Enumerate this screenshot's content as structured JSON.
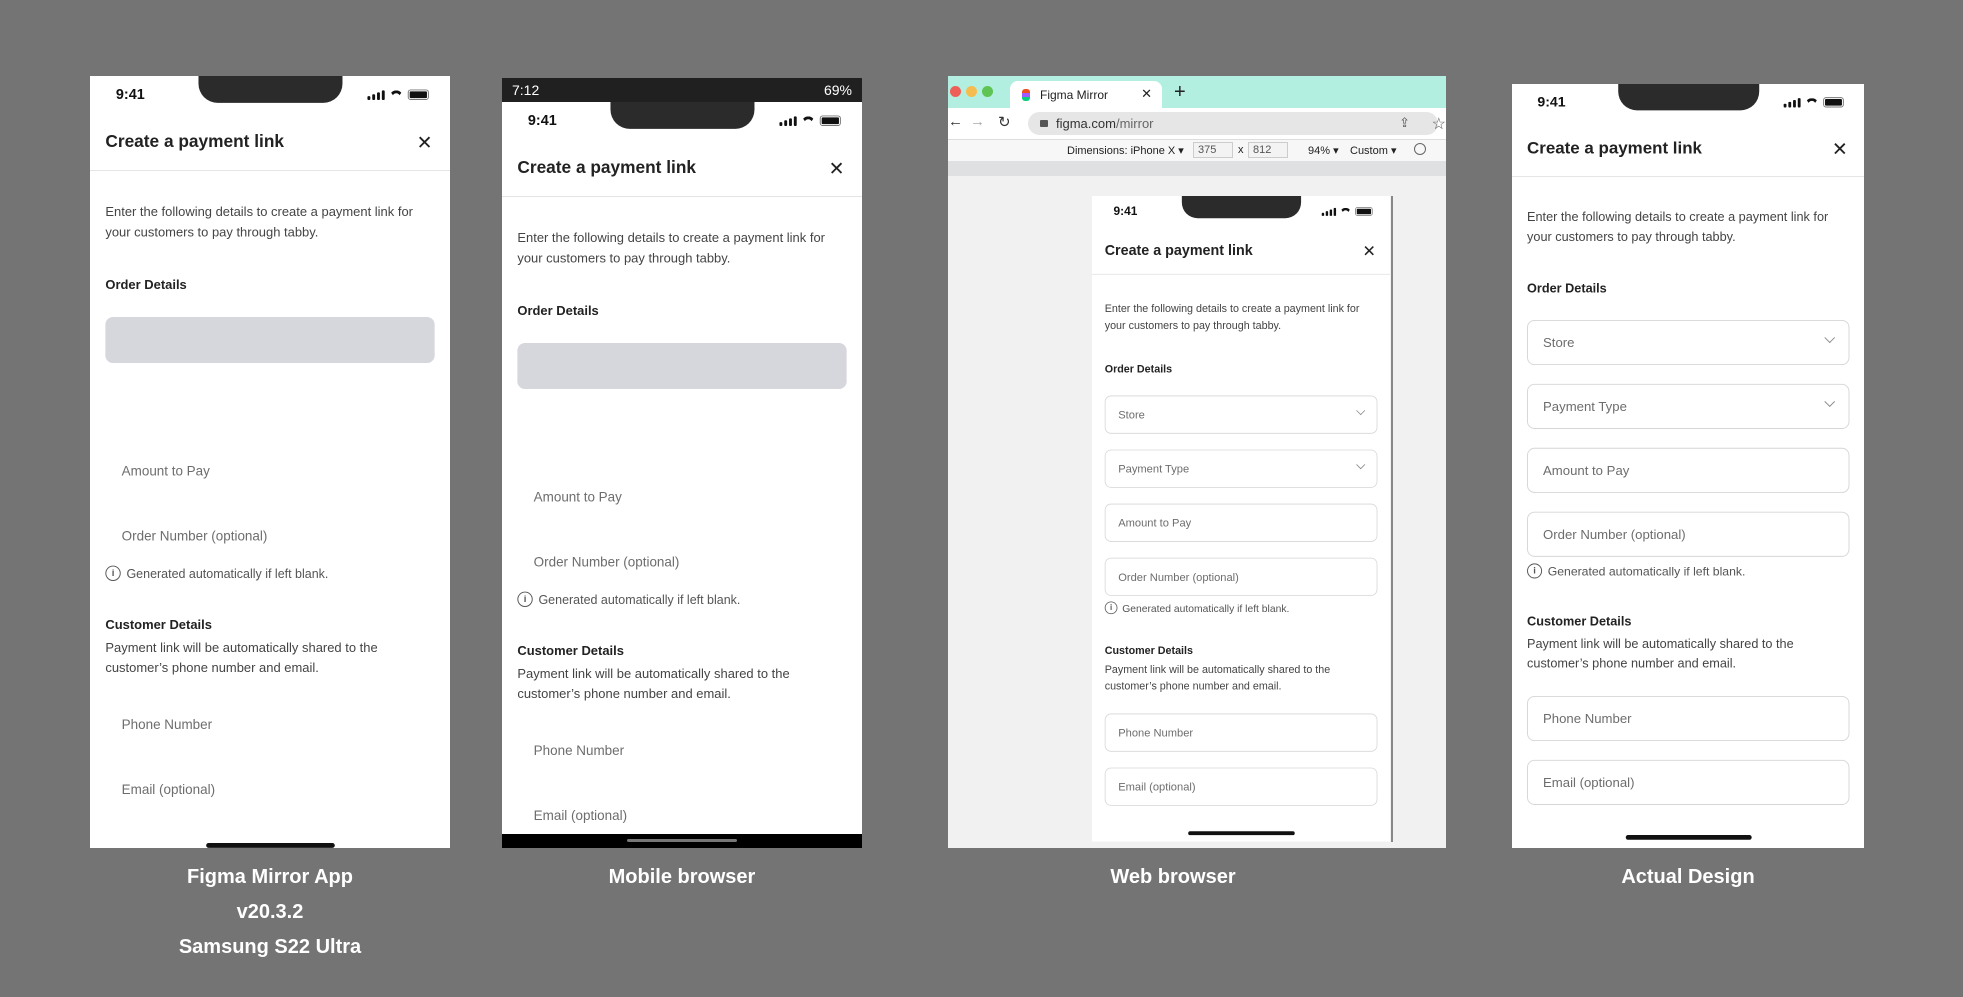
{
  "form": {
    "status_time": "9:41",
    "title": "Create a payment link",
    "close_icon": "close-icon",
    "description": "Enter the following details to create a payment link for your customers to pay through tabby.",
    "order_section": "Order Details",
    "store_placeholder": "Store",
    "payment_type_placeholder": "Payment Type",
    "amount_placeholder": "Amount to Pay",
    "order_number_placeholder": "Order Number (optional)",
    "order_number_helper": "Generated automatically if left blank.",
    "customer_section": "Customer Details",
    "customer_description": "Payment link will be automatically shared to the customer’s phone number and email.",
    "phone_placeholder": "Phone Number",
    "email_placeholder": "Email (optional)"
  },
  "android_status": {
    "time": "7:12",
    "battery": "69%"
  },
  "browser": {
    "tab_title": "Figma Mirror",
    "new_tab": "+",
    "url_domain": "figma.com",
    "url_path": "/mirror",
    "dimensions_label": "Dimensions: iPhone X ▾",
    "width": "375",
    "times": "x",
    "height": "812",
    "zoom": "94% ▾",
    "throttle": "Custom ▾",
    "accent": "#b2efe0"
  },
  "captions": {
    "figma_app": [
      "Figma Mirror App",
      "v20.3.2",
      "Samsung S22 Ultra"
    ],
    "mobile_browser": "Mobile browser",
    "web_browser": "Web browser",
    "actual_design": "Actual Design"
  }
}
